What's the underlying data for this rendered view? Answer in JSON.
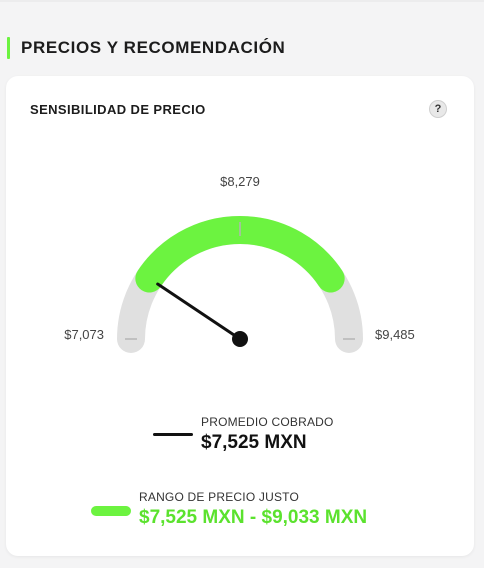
{
  "section": {
    "title": "PRECIOS Y RECOMENDACIÓN",
    "accent_color": "#6cf340"
  },
  "card": {
    "title": "SENSIBILIDAD DE PRECIO",
    "help_icon": "question-mark-icon",
    "help_label": "?"
  },
  "gauge": {
    "min_label": "$7,073",
    "mid_label": "$8,279",
    "max_label": "$9,485",
    "min": 7073,
    "max": 9485,
    "range_start": 7525,
    "range_end": 9033,
    "needle_value": 7525,
    "track_color": "#e0e0e0",
    "range_color": "#6cf340",
    "needle_color": "#111111"
  },
  "legend": {
    "average": {
      "label": "PROMEDIO COBRADO",
      "value": "$7,525 MXN"
    },
    "fair_range": {
      "label": "RANGO DE PRECIO JUSTO",
      "value": "$7,525 MXN - $9,033 MXN"
    }
  }
}
